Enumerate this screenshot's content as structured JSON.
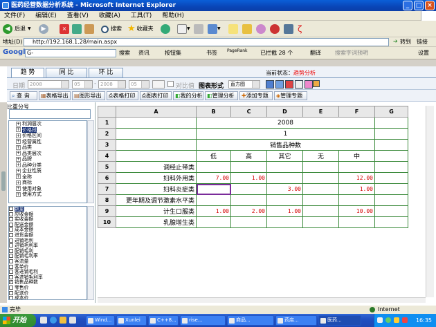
{
  "window": {
    "title": "医药经营数据分析系统 - Microsoft Internet Explorer"
  },
  "menu": [
    "文件(F)",
    "编辑(E)",
    "查看(V)",
    "收藏(A)",
    "工具(T)",
    "帮助(H)"
  ],
  "toolbar": {
    "back": "后退",
    "search": "搜索",
    "favorites": "收藏夹"
  },
  "address": {
    "label": "地址(D)",
    "url": "http://192.168.1.28/main.aspx",
    "go": "转到",
    "links": "链接"
  },
  "googlebar": {
    "logo": "Google",
    "search_box": "G-",
    "search": "搜索",
    "news": "资讯",
    "bookmarks": "按钮集",
    "favorites": "书签",
    "pagerank": "PageRank",
    "blocked": "已拦截 28 个",
    "translate": "翻译",
    "cut_word": "搜索字词预明",
    "settings": "设置"
  },
  "tabs": [
    {
      "label": "趋 势"
    },
    {
      "label": "同 比"
    },
    {
      "label": "环 比"
    }
  ],
  "current_state": {
    "label": "当前状态：",
    "value": "趋势分析"
  },
  "filter": {
    "date_label": "日期",
    "from_year": "2008",
    "from_month": "05",
    "to_year": "2008",
    "to_month": "05",
    "compare_label": "对比值",
    "chart_label": "图表形式",
    "chart_value": "直方图"
  },
  "actions": [
    "查 询",
    "表格导出",
    "图形导出",
    "表格打印",
    "图表打印",
    "我的分析",
    "管理分析",
    "添加专题",
    "管理专题"
  ],
  "left": {
    "header": "比重分号",
    "tree": [
      {
        "label": "利润层次",
        "sign": "+"
      },
      {
        "label": "价格段",
        "sign": "+",
        "selected": true
      },
      {
        "label": "价格区间",
        "sign": "+"
      },
      {
        "label": "经营属性",
        "sign": "+"
      },
      {
        "label": "品类",
        "sign": "+"
      },
      {
        "label": "品类层次",
        "sign": "+"
      },
      {
        "label": "品牌",
        "sign": "+"
      },
      {
        "label": "品种分类",
        "sign": "+"
      },
      {
        "label": "企业性质",
        "sign": "+"
      },
      {
        "label": "全称",
        "sign": "+"
      },
      {
        "label": "商标",
        "sign": "+"
      },
      {
        "label": "使用对象",
        "sign": "+"
      },
      {
        "label": "使用方式",
        "sign": "+"
      }
    ],
    "list": [
      {
        "label": "数量",
        "checked": false,
        "selected": true
      },
      {
        "label": "应收金额",
        "checked": false
      },
      {
        "label": "实收金额",
        "checked": false
      },
      {
        "label": "配送金额",
        "checked": false
      },
      {
        "label": "成本金额",
        "checked": false
      },
      {
        "label": "进货金额",
        "checked": false
      },
      {
        "label": "进销毛利",
        "checked": false
      },
      {
        "label": "进销毛利率",
        "checked": false
      },
      {
        "label": "配销毛利",
        "checked": false
      },
      {
        "label": "配销毛利率",
        "checked": false
      },
      {
        "label": "客流量",
        "checked": false
      },
      {
        "label": "客单价",
        "checked": false
      },
      {
        "label": "客进销毛利",
        "checked": false
      },
      {
        "label": "客进销毛利率",
        "checked": false
      },
      {
        "label": "销售品种数",
        "checked": true
      },
      {
        "label": "零售价",
        "checked": false
      },
      {
        "label": "配送价",
        "checked": false
      },
      {
        "label": "成本价",
        "checked": false
      }
    ]
  },
  "grid": {
    "columns": [
      "A",
      "B",
      "C",
      "D",
      "E",
      "F",
      "G"
    ],
    "rows": [
      {
        "n": "1",
        "a": "",
        "cells": [
          "",
          "",
          "2008",
          "",
          "",
          ""
        ]
      },
      {
        "n": "2",
        "a": "",
        "cells": [
          "",
          "",
          "1",
          "",
          "",
          ""
        ]
      },
      {
        "n": "3",
        "a": "",
        "cells": [
          "",
          "",
          "销售品种数",
          "",
          "",
          ""
        ]
      },
      {
        "n": "4",
        "a": "",
        "cells": [
          "低",
          "高",
          "其它",
          "无",
          "中",
          ""
        ]
      },
      {
        "n": "5",
        "a": "调经止带类",
        "cells": [
          "",
          "",
          "",
          "",
          "",
          ""
        ]
      },
      {
        "n": "6",
        "a": "妇科外用类",
        "cells": [
          "7.00",
          "1.00",
          "",
          "",
          "12.00",
          ""
        ]
      },
      {
        "n": "7",
        "a": "妇科炎症类",
        "cells": [
          "",
          "",
          "3.00",
          "",
          "1.00",
          ""
        ]
      },
      {
        "n": "8",
        "a": "更年期及调节激素水平类",
        "cells": [
          "",
          "",
          "",
          "",
          "",
          ""
        ]
      },
      {
        "n": "9",
        "a": "计生口服类",
        "cells": [
          "1.00",
          "2.00",
          "1.00",
          "",
          "10.00",
          ""
        ]
      },
      {
        "n": "10",
        "a": "乳腺增生类",
        "cells": [
          "",
          "",
          "",
          "",
          "",
          ""
        ]
      }
    ]
  },
  "status": {
    "left": "完毕",
    "zone": "Internet"
  },
  "taskbar": {
    "start": "开始",
    "tasks": [
      "Wind...",
      "Xunlei",
      "C++8...",
      "rise...",
      "商品...",
      "药店...",
      "医药..."
    ],
    "clock": "16:35"
  }
}
